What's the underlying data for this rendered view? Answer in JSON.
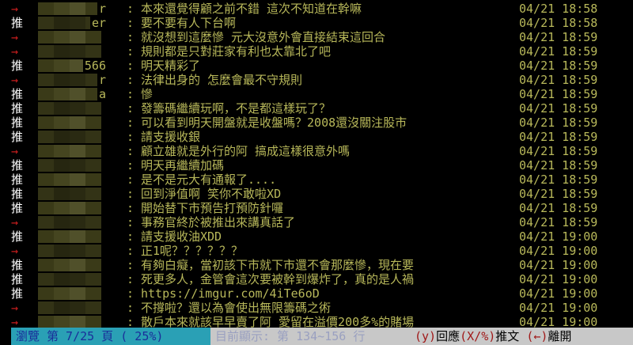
{
  "comments": [
    {
      "tag": "→",
      "kind": "arrow",
      "uid_tail": "r",
      "msg": "本來還覺得顧之前不錯 這次不知道在幹嘛",
      "ts": "04/21 18:58"
    },
    {
      "tag": "推",
      "kind": "push",
      "uid_tail": "er",
      "msg": "要不要有人下台啊",
      "ts": "04/21 18:58"
    },
    {
      "tag": "→",
      "kind": "arrow",
      "uid_tail": "",
      "msg": "就沒想到這麼慘 元大沒意外會直接結束這回合",
      "ts": "04/21 18:59"
    },
    {
      "tag": "→",
      "kind": "arrow",
      "uid_tail": "",
      "msg": "規則都是只對莊家有利也太靠北了吧",
      "ts": "04/21 18:59"
    },
    {
      "tag": "推",
      "kind": "push",
      "uid_tail": "566",
      "msg": "明天精彩了",
      "ts": "04/21 18:59"
    },
    {
      "tag": "→",
      "kind": "arrow",
      "uid_tail": "r",
      "msg": "法律出身的 怎麼會最不守規則",
      "ts": "04/21 18:59"
    },
    {
      "tag": "推",
      "kind": "push",
      "uid_tail": "a",
      "msg": "慘",
      "ts": "04/21 18:59"
    },
    {
      "tag": "推",
      "kind": "push",
      "uid_tail": "",
      "msg": "發籌碼繼續玩啊，不是都這樣玩了？",
      "ts": "04/21 18:59"
    },
    {
      "tag": "推",
      "kind": "push",
      "uid_tail": "",
      "msg": "可以看到明天開盤就是收盤嗎？2008還沒關注股市",
      "ts": "04/21 18:59"
    },
    {
      "tag": "推",
      "kind": "push",
      "uid_tail": "",
      "msg": "請支援收銀",
      "ts": "04/21 18:59"
    },
    {
      "tag": "→",
      "kind": "arrow",
      "uid_tail": "",
      "msg": "顧立雄就是外行的阿 搞成這樣很意外嗎",
      "ts": "04/21 18:59"
    },
    {
      "tag": "推",
      "kind": "push",
      "uid_tail": "",
      "msg": "明天再繼續加碼",
      "ts": "04/21 18:59"
    },
    {
      "tag": "推",
      "kind": "push",
      "uid_tail": "",
      "msg": "是不是元大有通報了....",
      "ts": "04/21 18:59"
    },
    {
      "tag": "推",
      "kind": "push",
      "uid_tail": "",
      "msg": "回到淨值啊 笑你不敢啦XD",
      "ts": "04/21 18:59"
    },
    {
      "tag": "推",
      "kind": "push",
      "uid_tail": "",
      "msg": "開始替下市預告打預防針囉",
      "ts": "04/21 18:59"
    },
    {
      "tag": "→",
      "kind": "arrow",
      "uid_tail": "",
      "msg": "事務官終於被推出來講真話了",
      "ts": "04/21 18:59"
    },
    {
      "tag": "推",
      "kind": "push",
      "uid_tail": "",
      "msg": "請支援收油XDD",
      "ts": "04/21 19:00"
    },
    {
      "tag": "→",
      "kind": "arrow",
      "uid_tail": "",
      "msg": "正1呢？？？？？？",
      "ts": "04/21 19:00"
    },
    {
      "tag": "推",
      "kind": "push",
      "uid_tail": "",
      "msg": "有夠白癡，當初該下市就下市還不會那麼慘，現在要",
      "ts": "04/21 19:00"
    },
    {
      "tag": "推",
      "kind": "push",
      "uid_tail": "",
      "msg": "死更多人，金管會這次要被幹到爆炸了，真的是人禍",
      "ts": "04/21 19:00"
    },
    {
      "tag": "推",
      "kind": "push",
      "uid_tail": "",
      "msg": "https://imgur.com/4iTe6oD",
      "ts": "04/21 19:00"
    },
    {
      "tag": "→",
      "kind": "arrow",
      "uid_tail": "",
      "msg": "不撐啦？還以為會使出無限籌碼之術",
      "ts": "04/21 19:00"
    },
    {
      "tag": "→",
      "kind": "arrow",
      "uid_tail": "",
      "msg": "散戶本來就該早早賣了阿 愛留在溢價200多%的賭場",
      "ts": "04/21 19:00"
    }
  ],
  "status_bar": {
    "browse": "瀏覽 第 7/25 頁 ( 25%)",
    "showing": "目前顯示: 第 134~156 行",
    "reply_key": "(y)",
    "reply_label": "回應",
    "push_key": "(X/%)",
    "push_label": "推文",
    "leave_key": "(←)",
    "leave_label": "離開"
  },
  "colors": {
    "text": "#b8b85a",
    "arrow": "#c81e1e",
    "push": "#ffffff",
    "status_blue": "#2aa0b5",
    "status_grey": "#c8c8c8"
  }
}
